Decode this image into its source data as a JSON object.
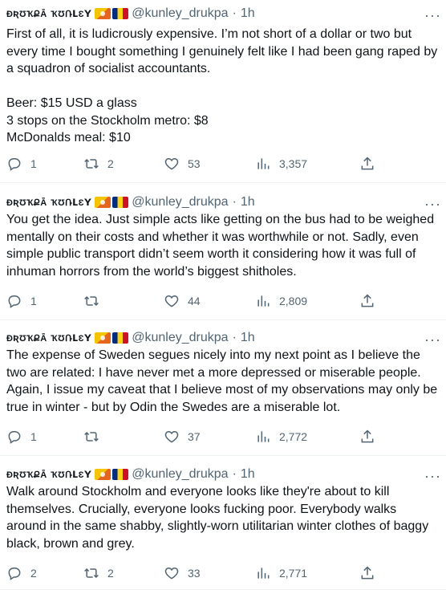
{
  "author": {
    "name": "ɖʀʊҡքǟ ҡʊռʟɛʏ",
    "handle": "@kunley_drukpa",
    "time": "1h",
    "flags": [
      "bhutan-flag",
      "romania-flag"
    ]
  },
  "tweets": [
    {
      "text": "First of all, it is ludicrously expensive. I’m not short of a dollar or two but every time I bought something I genuinely felt like I had been gang raped by a squadron of socialist accountants.\n\nBeer: $15 USD a glass\n3 stops on the Stockholm metro: $8\nMcDonalds meal: $10",
      "replies": "1",
      "retweets": "2",
      "likes": "53",
      "views": "3,357"
    },
    {
      "text": "You get the idea. Just simple acts like getting on the bus had to be weighed mentally on their costs and whether it was worthwhile or not. Sadly, even simple public transport didn’t seem worth it considering how it was full of inhuman horrors from the world’s biggest shitholes.",
      "replies": "1",
      "retweets": "",
      "likes": "44",
      "views": "2,809"
    },
    {
      "text": "The expense of Sweden segues nicely into my next point as I believe the two are related: I have never met a more depressed or miserable people. Again, I issue my caveat that I believe most of my observations may only be true in winter - but by Odin the Swedes are a miserable lot.",
      "replies": "1",
      "retweets": "",
      "likes": "37",
      "views": "2,772"
    },
    {
      "text": "Walk around Stockholm and everyone looks like they're about to kill themselves. Crucially, everyone looks fucking poor. Everybody walks around in the same shabby, slightly-worn utilitarian winter clothes of baggy black, brown and grey.",
      "replies": "2",
      "retweets": "2",
      "likes": "33",
      "views": "2,771"
    }
  ],
  "more_label": "···",
  "dot": "·"
}
